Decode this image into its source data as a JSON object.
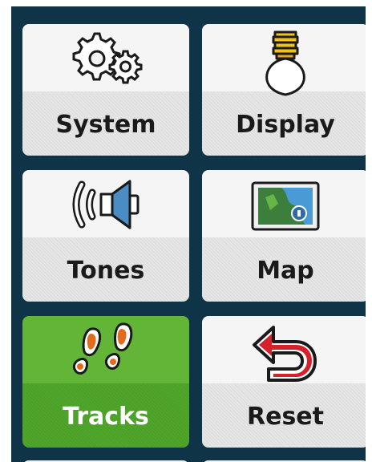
{
  "menu": {
    "items": [
      {
        "label": "System",
        "icon": "gears-icon",
        "selected": false
      },
      {
        "label": "Display",
        "icon": "lightbulb-icon",
        "selected": false
      },
      {
        "label": "Tones",
        "icon": "speaker-icon",
        "selected": false
      },
      {
        "label": "Map",
        "icon": "map-icon",
        "selected": false
      },
      {
        "label": "Tracks",
        "icon": "footprints-icon",
        "selected": true
      },
      {
        "label": "Reset",
        "icon": "reset-arrow-icon",
        "selected": false
      }
    ]
  },
  "colors": {
    "background": "#0f3448",
    "tile_top": "#f5f5f5",
    "tile_bottom": "#e5e5e5",
    "selected_tile": "#5aaf30",
    "selected_text": "#ffffff",
    "text": "#1a1a1a"
  }
}
